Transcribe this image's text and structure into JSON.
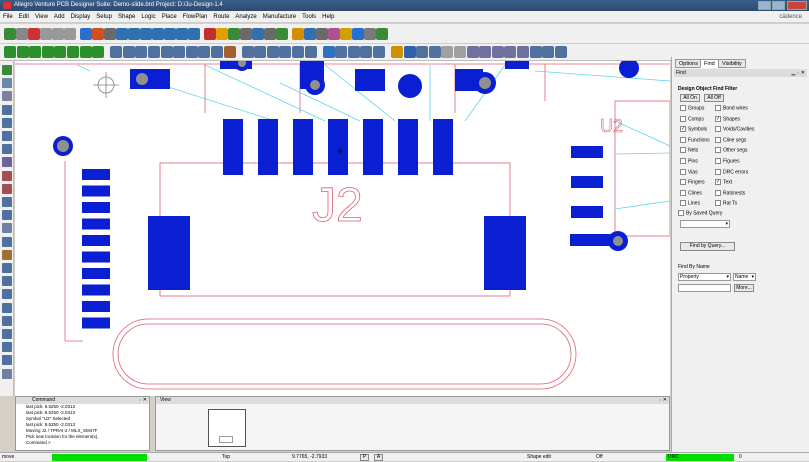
{
  "window": {
    "title": "Allegro Venture PCB Designer Suite: Demo-slide.brd  Project: D:/Ju-Design-1.4"
  },
  "menu": [
    "File",
    "Edit",
    "View",
    "Add",
    "Display",
    "Setup",
    "Shape",
    "Logic",
    "Place",
    "FlowPlan",
    "Route",
    "Analyze",
    "Manufacture",
    "Tools",
    "Help"
  ],
  "menu_right": "cādence",
  "canvas": {
    "refdes_j2": "J2",
    "refdes_u2": "U2"
  },
  "right_panel": {
    "tabs": [
      "Options",
      "Find",
      "Visibility"
    ],
    "active_tab": "Find",
    "find_header": "Find",
    "filter_title": "Design Object Find Filter",
    "all_on": "All On",
    "all_off": "All Off",
    "left_items": [
      {
        "label": "Groups",
        "checked": false
      },
      {
        "label": "Comps",
        "checked": false
      },
      {
        "label": "Symbols",
        "checked": true
      },
      {
        "label": "Functions",
        "checked": false
      },
      {
        "label": "Nets",
        "checked": false
      },
      {
        "label": "Pins",
        "checked": false
      },
      {
        "label": "Vias",
        "checked": false
      },
      {
        "label": "Fingers",
        "checked": false
      },
      {
        "label": "Clines",
        "checked": false
      },
      {
        "label": "Lines",
        "checked": false
      }
    ],
    "right_items": [
      {
        "label": "Bond wires",
        "checked": false
      },
      {
        "label": "Shapes",
        "checked": true
      },
      {
        "label": "Voids/Cavities",
        "checked": false
      },
      {
        "label": "Cline segs",
        "checked": false
      },
      {
        "label": "Other segs",
        "checked": false
      },
      {
        "label": "Figures",
        "checked": false
      },
      {
        "label": "DRC errors",
        "checked": false
      },
      {
        "label": "Text",
        "checked": true
      },
      {
        "label": "Ratsnests",
        "checked": false
      },
      {
        "label": "Rat Ts",
        "checked": false
      }
    ],
    "by_saved_query": "By Saved Query",
    "find_by_query": "Find by Query...",
    "find_by_name": "Find By Name",
    "property_select": "Property",
    "name_select": "Name",
    "more_button": "More..."
  },
  "command_panel": {
    "title": "Command",
    "lines": [
      "last pick:  9.5250 -2.0313",
      "last pick:  9.5250 -2.0313",
      "Symbol \"U2\" Selected",
      "last pick:  9.5250 -2.0313",
      "Moving J2 / TPRAI-2 / MLX_SM47F",
      "Pick new location for the element(s).",
      "Command >"
    ]
  },
  "view_panel": {
    "title": "View"
  },
  "status": {
    "mode": "move",
    "layer": "Top",
    "coords": "9.7765, -2.7933",
    "p_btn": "P",
    "a_btn": "A",
    "shape_mode": "Shape edit",
    "off": "Off",
    "drc": "DRC",
    "drc_count": "0",
    "green": "#00dd00",
    "pad": "#0a1ed2",
    "ratsnest": "#5fd4f0",
    "silk": "#e06070"
  }
}
